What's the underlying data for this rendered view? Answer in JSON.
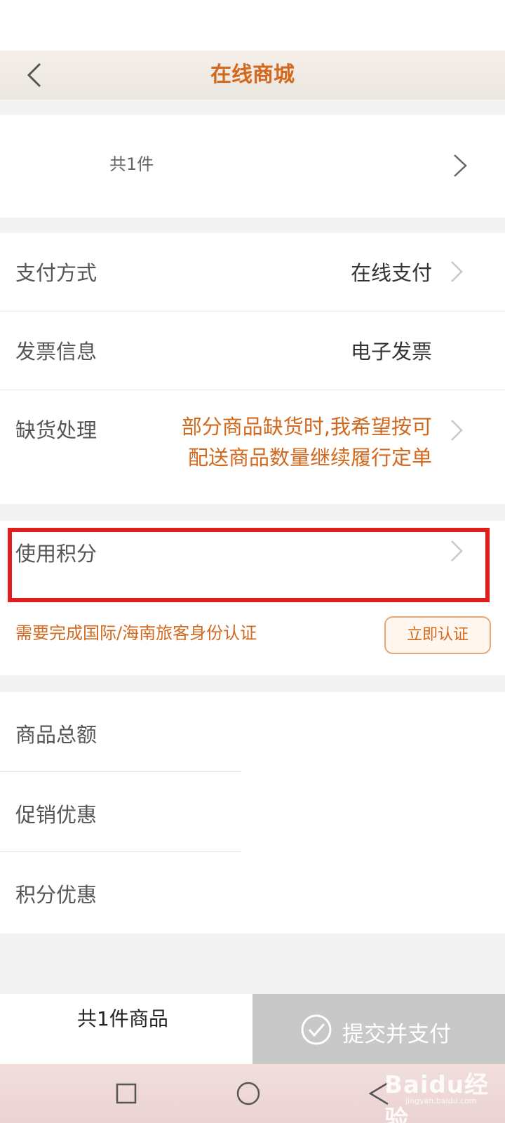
{
  "nav": {
    "title": "在线商城"
  },
  "items_summary": {
    "count_text": "共1件"
  },
  "options": [
    {
      "label": "支付方式",
      "value": "在线支付"
    },
    {
      "label": "发票信息",
      "value": "电子发票"
    },
    {
      "label": "缺货处理",
      "value_line1": "部分商品缺货时,我希望按可",
      "value_line2": "配送商品数量继续履行定单"
    }
  ],
  "points": {
    "label": "使用积分",
    "notice": "需要完成国际/海南旅客身份认证",
    "verify_button": "立即认证"
  },
  "summary": [
    {
      "label": "商品总额"
    },
    {
      "label": "促销优惠"
    },
    {
      "label": "积分优惠"
    }
  ],
  "bottom_bar": {
    "total_text": "共1件商品",
    "submit_label": "提交并支付",
    "submit_icon": "check-circle-icon"
  },
  "system_nav": {
    "icons": [
      "recent-apps-icon",
      "home-icon",
      "back-triangle-icon"
    ]
  },
  "watermark": {
    "text": "Baidu经验",
    "sub": "jingyan.baidu.com"
  },
  "colors": {
    "accent": "#d2691e",
    "highlight": "#e11c1c",
    "submit_disabled": "#c8c8c8"
  }
}
